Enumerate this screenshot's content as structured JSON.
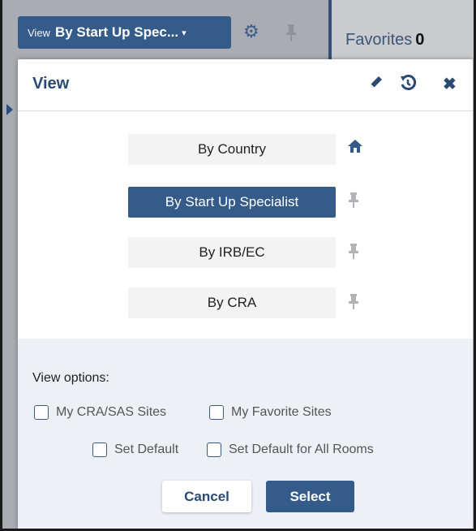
{
  "background": {
    "view_dropdown": {
      "prefix": "View",
      "value": "By Start Up Spec...",
      "caret": "▾"
    },
    "gear_icon": "⚙",
    "pin_icon": "📌",
    "favorites": {
      "label": "Favorites",
      "count": "0"
    }
  },
  "dialog": {
    "title": "View",
    "edit_icon": "✎",
    "history_icon": "↺",
    "close_icon": "✖",
    "options": [
      {
        "label": "By Country",
        "selected": false,
        "marker": "home"
      },
      {
        "label": "By Start Up Specialist",
        "selected": true,
        "marker": "pin"
      },
      {
        "label": "By IRB/EC",
        "selected": false,
        "marker": "pin"
      },
      {
        "label": "By CRA",
        "selected": false,
        "marker": "pin"
      }
    ],
    "home_icon": "⌂",
    "pin_glyph": "⊥",
    "view_options": {
      "label": "View options:",
      "checkboxes": [
        {
          "label": "My CRA/SAS Sites",
          "checked": false
        },
        {
          "label": "My Favorite Sites",
          "checked": false
        },
        {
          "label": "Set Default",
          "checked": false
        },
        {
          "label": "Set Default for All Rooms",
          "checked": false
        }
      ]
    },
    "buttons": {
      "cancel": "Cancel",
      "select": "Select"
    }
  },
  "colors": {
    "primary": "#355b8a",
    "primary_dark": "#2a4a73",
    "footer_bg": "#edf1f5",
    "option_bg": "#f3f3f3"
  }
}
